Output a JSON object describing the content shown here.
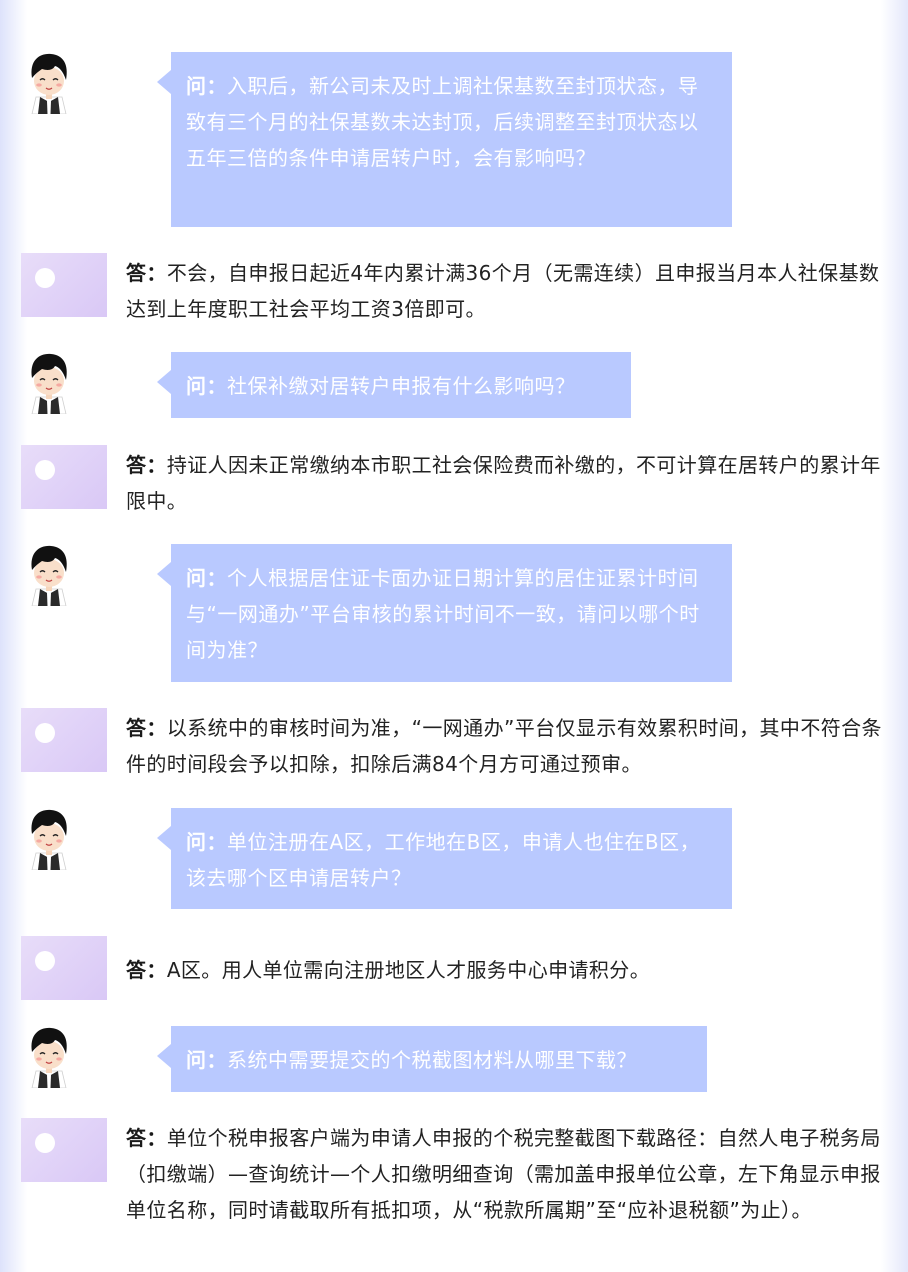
{
  "q_label": "问：",
  "a_label": "答：",
  "items": [
    {
      "question": "入职后，新公司未及时上调社保基数至封顶状态，导致有三个月的社保基数未达封顶，后续调整至封顶状态以五年三倍的条件申请居转户时，会有影响吗？",
      "answer": "不会，自申报日起近4年内累计满36个月（无需连续）且申报当月本人社保基数达到上年度职工社会平均工资3倍即可。"
    },
    {
      "question": "社保补缴对居转户申报有什么影响吗？",
      "answer": "持证人因未正常缴纳本市职工社会保险费而补缴的，不可计算在居转户的累计年限中。"
    },
    {
      "question": "个人根据居住证卡面办证日期计算的居住证累计时间与“一网通办”平台审核的累计时间不一致，请问以哪个时间为准？",
      "answer": "以系统中的审核时间为准，“一网通办”平台仅显示有效累积时间，其中不符合条件的时间段会予以扣除，扣除后满84个月方可通过预审。"
    },
    {
      "question": "单位注册在A区，工作地在B区，申请人也住在B区，该去哪个区申请居转户？",
      "answer": "A区。用人单位需向注册地区人才服务中心申请积分。"
    },
    {
      "question": "系统中需要提交的个税截图材料从哪里下载？",
      "answer": "单位个税申报客户端为申请人申报的个税完整截图下载路径：自然人电子税务局（扣缴端）—查询统计—个人扣缴明细查询（需加盖申报单位公章，左下角显示申报单位名称，同时请截取所有抵扣项，从“税款所属期”至“应补退税额”为止）。"
    }
  ]
}
